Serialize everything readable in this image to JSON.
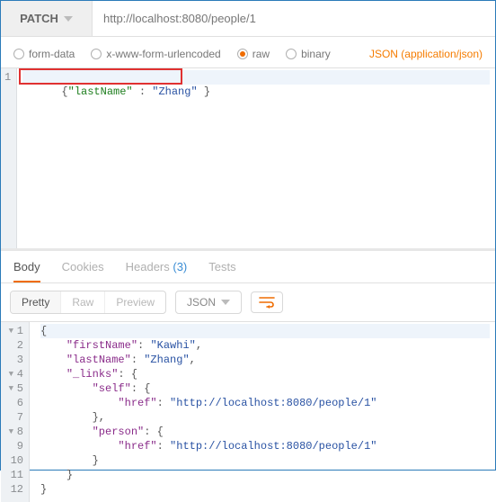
{
  "request": {
    "method": "PATCH",
    "url": "http://localhost:8080/people/1"
  },
  "body_types": {
    "form_data": "form-data",
    "urlencoded": "x-www-form-urlencoded",
    "raw": "raw",
    "binary": "binary",
    "selected": "raw",
    "content_type": "JSON (application/json)"
  },
  "request_body": {
    "line1": {
      "full": "{\"lastName\" : \"Zhang\" }"
    }
  },
  "response_tabs": {
    "body": "Body",
    "cookies": "Cookies",
    "headers": "Headers",
    "headers_count": "(3)",
    "tests": "Tests"
  },
  "response_toolbar": {
    "pretty": "Pretty",
    "raw": "Raw",
    "preview": "Preview",
    "format": "JSON"
  },
  "response_body": {
    "lines": [
      {
        "n": 1,
        "indent": 0,
        "fold": true,
        "tokens": [
          [
            "punc",
            "{"
          ]
        ]
      },
      {
        "n": 2,
        "indent": 2,
        "tokens": [
          [
            "key",
            "\"firstName\""
          ],
          [
            "punc",
            ": "
          ],
          [
            "str",
            "\"Kawhi\""
          ],
          [
            "punc",
            ","
          ]
        ]
      },
      {
        "n": 3,
        "indent": 2,
        "tokens": [
          [
            "key",
            "\"lastName\""
          ],
          [
            "punc",
            ": "
          ],
          [
            "str",
            "\"Zhang\""
          ],
          [
            "punc",
            ","
          ]
        ]
      },
      {
        "n": 4,
        "indent": 2,
        "fold": true,
        "tokens": [
          [
            "key",
            "\"_links\""
          ],
          [
            "punc",
            ": {"
          ]
        ]
      },
      {
        "n": 5,
        "indent": 4,
        "fold": true,
        "tokens": [
          [
            "key",
            "\"self\""
          ],
          [
            "punc",
            ": {"
          ]
        ]
      },
      {
        "n": 6,
        "indent": 6,
        "tokens": [
          [
            "key",
            "\"href\""
          ],
          [
            "punc",
            ": "
          ],
          [
            "str",
            "\"http://localhost:8080/people/1\""
          ]
        ]
      },
      {
        "n": 7,
        "indent": 4,
        "tokens": [
          [
            "punc",
            "},"
          ]
        ]
      },
      {
        "n": 8,
        "indent": 4,
        "fold": true,
        "tokens": [
          [
            "key",
            "\"person\""
          ],
          [
            "punc",
            ": {"
          ]
        ]
      },
      {
        "n": 9,
        "indent": 6,
        "tokens": [
          [
            "key",
            "\"href\""
          ],
          [
            "punc",
            ": "
          ],
          [
            "str",
            "\"http://localhost:8080/people/1\""
          ]
        ]
      },
      {
        "n": 10,
        "indent": 4,
        "tokens": [
          [
            "punc",
            "}"
          ]
        ]
      },
      {
        "n": 11,
        "indent": 2,
        "tokens": [
          [
            "punc",
            "}"
          ]
        ]
      },
      {
        "n": 12,
        "indent": 0,
        "tokens": [
          [
            "punc",
            "}"
          ]
        ]
      }
    ]
  }
}
